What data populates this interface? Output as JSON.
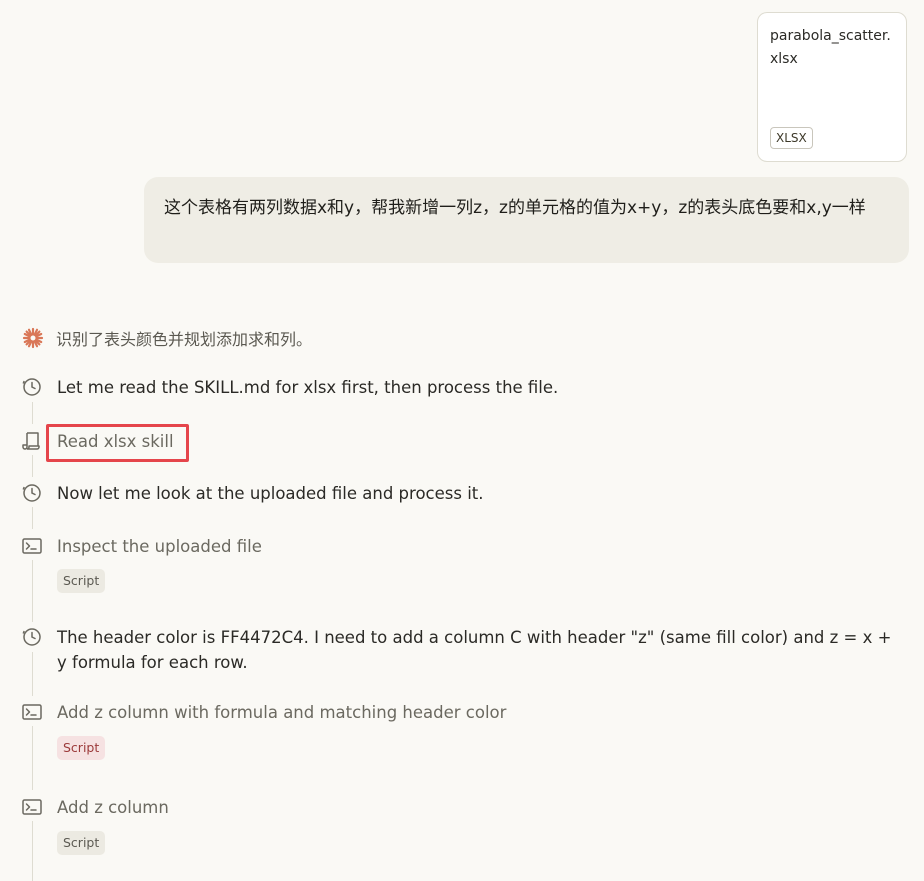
{
  "attachment": {
    "filename": "parabola_scatter.xlsx",
    "type_label": "XLSX"
  },
  "user_message": {
    "text": "这个表格有两列数据x和y，帮我新增一列z，z的单元格的值为x+y，z的表头底色要和x,y一样"
  },
  "thinking_summary": {
    "icon": "spark-icon",
    "text": "识别了表头颜色并规划添加求和列。",
    "accent_color": "#d97757"
  },
  "steps": [
    {
      "icon": "clock-icon",
      "text": "Let me read the SKILL.md for xlsx first, then process the file."
    },
    {
      "icon": "scroll-icon",
      "text": "Read xlsx skill"
    },
    {
      "icon": "clock-icon",
      "text": "Now let me look at the uploaded file and process it."
    },
    {
      "icon": "terminal-icon",
      "text": "Inspect the uploaded file",
      "badge": "Script"
    },
    {
      "icon": "clock-icon",
      "text": "The header color is FF4472C4. I need to add a column C with header \"z\" (same fill color) and z = x + y formula for each row."
    },
    {
      "icon": "terminal-icon",
      "text": "Add z column with formula and matching header color",
      "badge": "Script"
    },
    {
      "icon": "terminal-icon",
      "text": "Add z column",
      "badge": "Script"
    }
  ],
  "highlight_color": "#e5454b"
}
